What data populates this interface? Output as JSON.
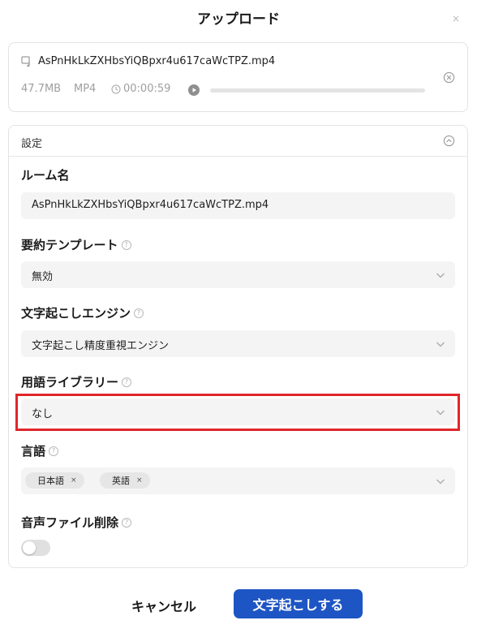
{
  "dialog": {
    "title": "アップロード",
    "close_glyph": "×"
  },
  "file": {
    "name": "AsPnHkLkZXHbsYiQBpxr4u617caWcTPZ.mp4",
    "size": "47.7MB",
    "format": "MP4",
    "duration": "00:00:59",
    "playback_progress": 0,
    "icons": [
      "file-audio-icon",
      "clock-icon",
      "play-icon",
      "remove-circle-icon"
    ]
  },
  "settings": {
    "title": "設定",
    "room_name": {
      "label": "ルーム名",
      "value": "AsPnHkLkZXHbsYiQBpxr4u617caWcTPZ.mp4"
    },
    "summary_template": {
      "label": "要約テンプレート",
      "value": "無効"
    },
    "transcription_engine": {
      "label": "文字起こしエンジン",
      "value": "文字起こし精度重視エンジン"
    },
    "glossary": {
      "label": "用語ライブラリー",
      "value": "なし",
      "highlighted": true
    },
    "language": {
      "label": "言語",
      "tags": [
        "日本語",
        "英語"
      ],
      "tag_remove_glyph": "×"
    },
    "delete_audio": {
      "label": "音声ファイル削除",
      "enabled": false
    },
    "help_glyph": "?"
  },
  "footer": {
    "cancel_label": "キャンセル",
    "submit_label": "文字起こしする"
  },
  "colors": {
    "primary": "#1e55c4",
    "highlight_border": "#e0262a",
    "field_bg": "#f4f4f4",
    "muted_text": "#9e9e9e"
  }
}
